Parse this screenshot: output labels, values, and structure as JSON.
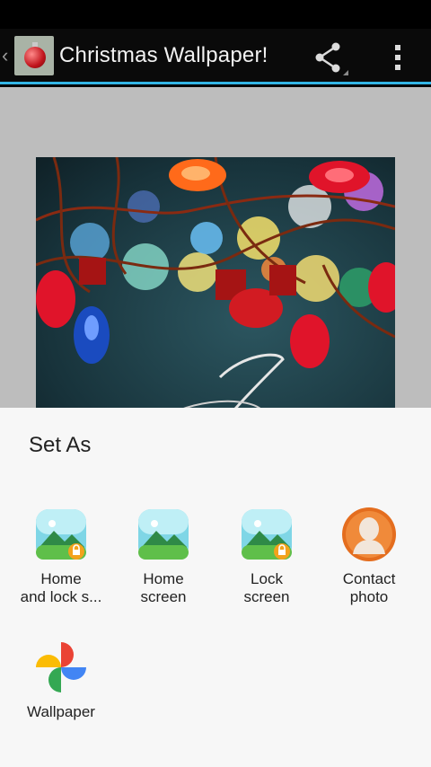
{
  "action_bar": {
    "title": "Christmas Wallpaper!",
    "up_icon": "chevron-left-icon",
    "share_icon": "share-icon",
    "overflow_icon": "more-vert-icon",
    "accent_color": "#33b5e5"
  },
  "sheet": {
    "title": "Set As",
    "options": [
      {
        "label_line1": "Home",
        "label_line2": "and lock s...",
        "icon": "home-lock-screen-icon"
      },
      {
        "label_line1": "Home",
        "label_line2": "screen",
        "icon": "home-screen-icon"
      },
      {
        "label_line1": "Lock",
        "label_line2": "screen",
        "icon": "lock-screen-icon"
      },
      {
        "label_line1": "Contact",
        "label_line2": "photo",
        "icon": "contact-photo-icon"
      },
      {
        "label_line1": "Wallpaper",
        "label_line2": "",
        "icon": "google-photos-icon"
      }
    ]
  }
}
